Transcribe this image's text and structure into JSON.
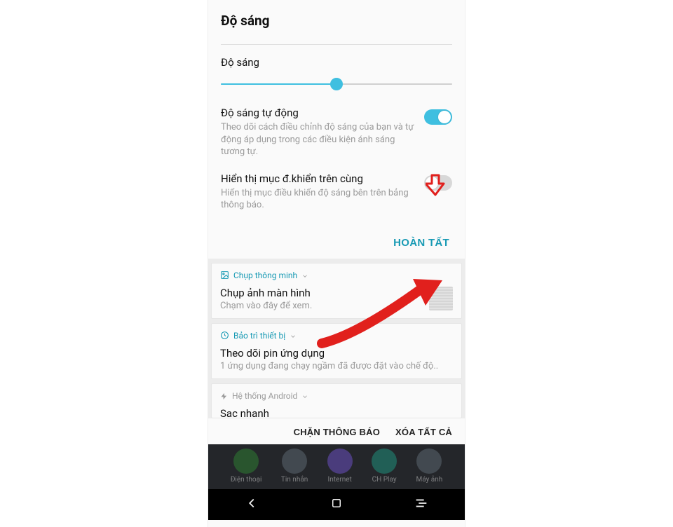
{
  "panel": {
    "title": "Độ sáng",
    "section_label": "Độ sáng",
    "slider_percent": 50,
    "auto": {
      "title": "Độ sáng tự động",
      "desc": "Theo dõi cách điều chỉnh độ sáng của bạn và tự động áp dụng trong các điều kiện ánh sáng tương tự.",
      "on": true
    },
    "control_top": {
      "title": "Hiển thị mục đ.khiển trên cùng",
      "desc": "Hiển thị mục điều khiển độ sáng bên trên bảng thông báo.",
      "on": false
    },
    "done": "HOÀN TẤT"
  },
  "notifications": {
    "smart_capture": {
      "app": "Chụp thông minh",
      "title": "Chụp ảnh màn hình",
      "desc": "Chạm vào đây để xem."
    },
    "maintenance": {
      "app": "Bảo trì thiết bị",
      "title": "Theo dõi pin ứng dụng",
      "desc": "1 ứng dụng đang chạy ngầm đã được đặt vào chế độ.."
    },
    "android": {
      "app": "Hệ thống Android",
      "title": "Sạc nhanh"
    },
    "actions": {
      "block": "CHẶN THÔNG BÁO",
      "clear": "XÓA TẤT CẢ"
    }
  },
  "dock": {
    "items": [
      {
        "label": "Điện thoại",
        "color": "#2e7d32"
      },
      {
        "label": "Tin nhắn",
        "color": "#5b6770"
      },
      {
        "label": "Internet",
        "color": "#6a4fbf"
      },
      {
        "label": "CH Play",
        "color": "#1f8f7a"
      },
      {
        "label": "Máy ảnh",
        "color": "#5b6770"
      }
    ]
  }
}
